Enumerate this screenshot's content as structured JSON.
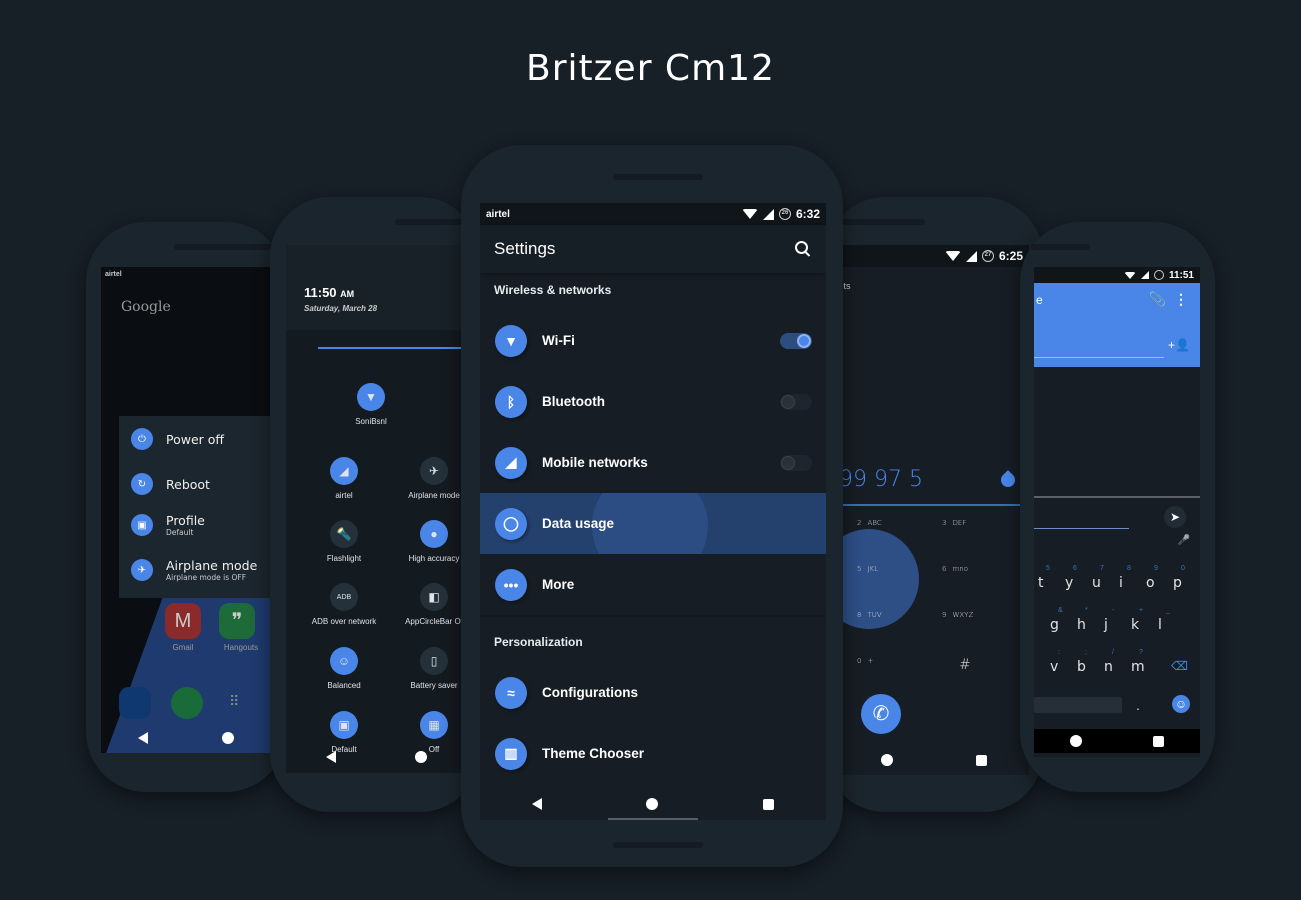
{
  "title": "Britzer Cm12",
  "accent": "#4a86e8",
  "main_phone": {
    "status_bar": {
      "carrier": "airtel",
      "battery": "26",
      "time": "6:32"
    },
    "app_bar": {
      "title": "Settings",
      "search_icon": "search-icon"
    },
    "sections": [
      {
        "header": "Wireless & networks",
        "items": [
          {
            "label": "Wi-Fi",
            "icon": "wifi-icon",
            "toggle": "on"
          },
          {
            "label": "Bluetooth",
            "icon": "bluetooth-icon",
            "toggle": "off"
          },
          {
            "label": "Mobile networks",
            "icon": "signal-icon",
            "toggle": "off"
          },
          {
            "label": "Data usage",
            "icon": "data-usage-icon",
            "pressed": true
          },
          {
            "label": "More",
            "icon": "more-icon"
          }
        ]
      },
      {
        "header": "Personalization",
        "items": [
          {
            "label": "Configurations",
            "icon": "configurations-icon"
          },
          {
            "label": "Theme Chooser",
            "icon": "theme-chooser-icon"
          }
        ]
      }
    ]
  },
  "phone1": {
    "carrier": "airtel",
    "search_brand": "Google",
    "power_menu": [
      {
        "label": "Power off",
        "sub": ""
      },
      {
        "label": "Reboot",
        "sub": ""
      },
      {
        "label": "Profile",
        "sub": "Default"
      },
      {
        "label": "Airplane mode",
        "sub": "Airplane mode is OFF"
      }
    ],
    "apps": [
      "Gmail",
      "Hangouts"
    ]
  },
  "phone2": {
    "time": "11:50",
    "ampm": "AM",
    "date": "Saturday, March 28",
    "tiles": [
      "SoniBsnl",
      "airtel",
      "Airplane mode",
      "Flashlight",
      "High accuracy",
      "ADB over network",
      "AppCircleBar Of",
      "Balanced",
      "Battery saver",
      "Default",
      "Off"
    ]
  },
  "phone4": {
    "status_bar": {
      "battery": "27",
      "time": "6:25"
    },
    "tab_fragment": "cts",
    "number": "99 97 5",
    "keys": [
      {
        "d": "2",
        "l": "ABC"
      },
      {
        "d": "3",
        "l": "DEF"
      },
      {
        "d": "5",
        "l": "JKL"
      },
      {
        "d": "6",
        "l": "mno"
      },
      {
        "d": "8",
        "l": "TUV"
      },
      {
        "d": "9",
        "l": "WXYZ"
      },
      {
        "d": "0",
        "l": "+"
      },
      {
        "d": "#",
        "l": ""
      }
    ]
  },
  "phone5": {
    "status_bar": {
      "time": "11:51"
    },
    "title_fragment": "e",
    "keyboard": {
      "row1": [
        "t",
        "y",
        "u",
        "i",
        "o",
        "p"
      ],
      "row1_sym": [
        "5",
        "6",
        "7",
        "8",
        "9",
        "0"
      ],
      "row2": [
        "g",
        "h",
        "j",
        "k",
        "l"
      ],
      "row2_sym": [
        "&",
        "*",
        "-",
        "+",
        "_"
      ],
      "row3": [
        "v",
        "b",
        "n",
        "m"
      ],
      "row3_sym": [
        ":",
        ";",
        "/",
        "?"
      ],
      "period": "."
    }
  }
}
